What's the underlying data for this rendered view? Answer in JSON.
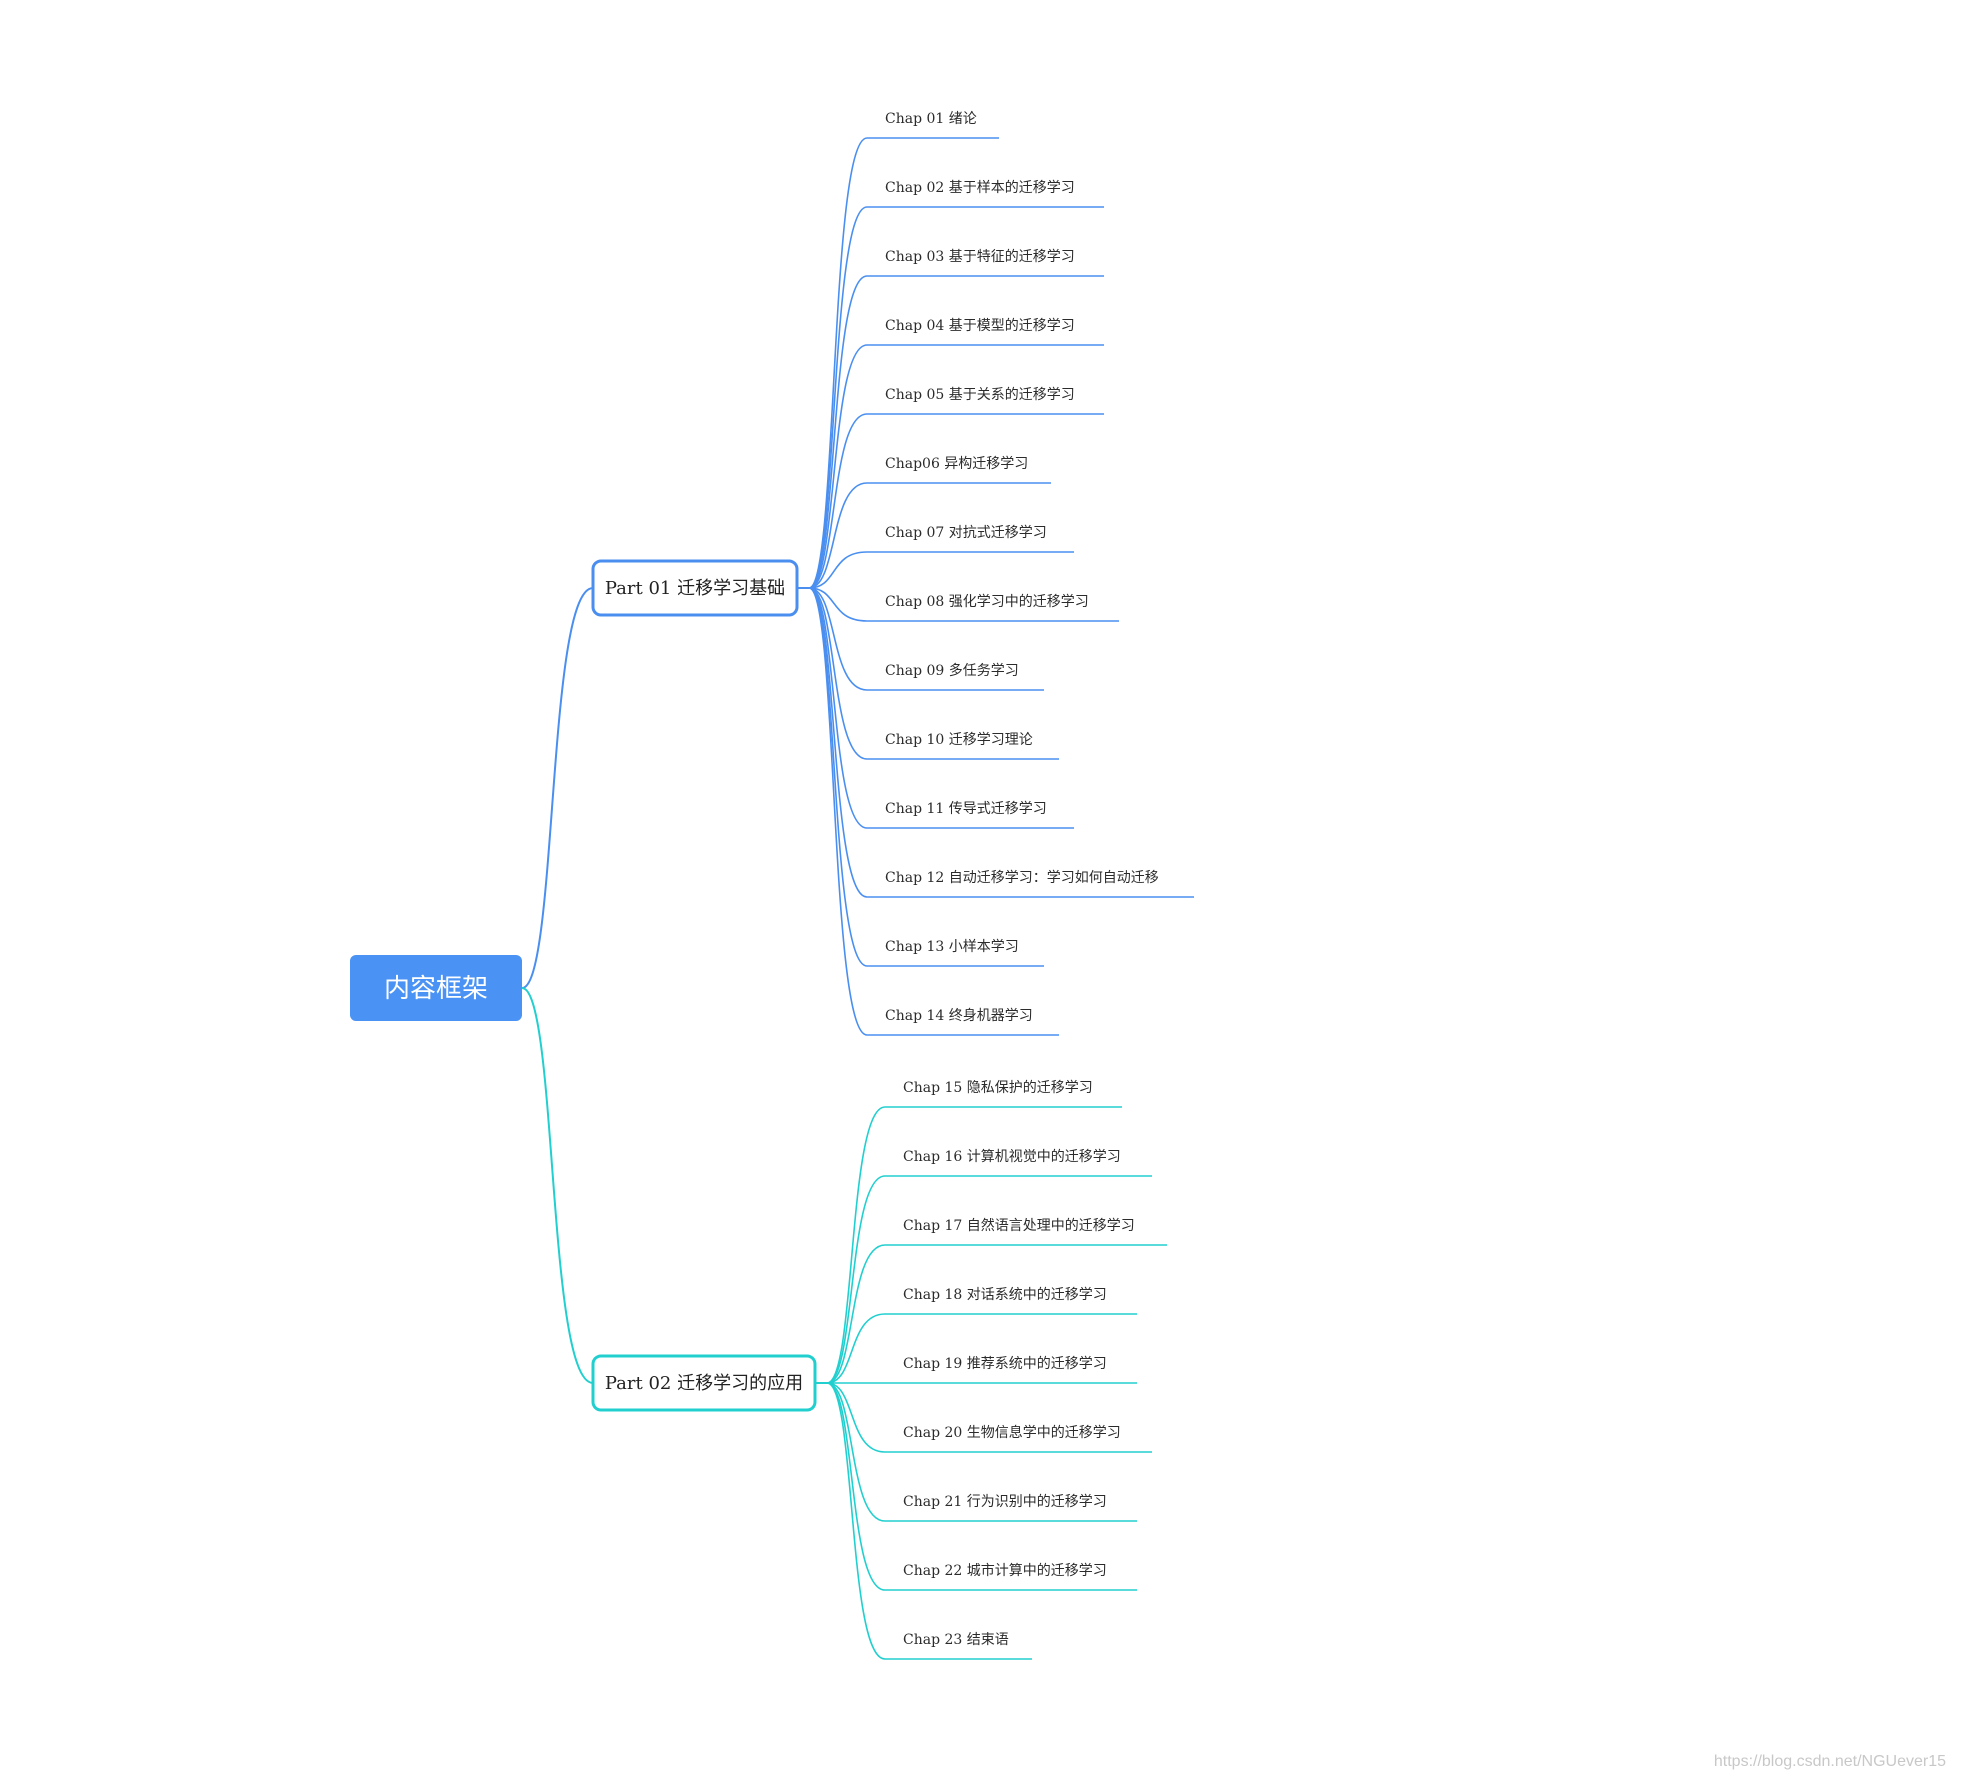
{
  "root": {
    "label": "内容框架",
    "color": "#4a93f4"
  },
  "branches": [
    {
      "label": "Part 01 迁移学习基础",
      "color": "#4a8ff0",
      "children": [
        "Chap 01 绪论",
        "Chap 02 基于样本的迁移学习",
        "Chap 03 基于特征的迁移学习",
        "Chap 04 基于模型的迁移学习",
        "Chap 05 基于关系的迁移学习",
        "Chap06 异构迁移学习",
        "Chap 07 对抗式迁移学习",
        "Chap 08 强化学习中的迁移学习",
        "Chap 09 多任务学习",
        "Chap 10 迁移学习理论",
        "Chap 11 传导式迁移学习",
        "Chap 12 自动迁移学习：学习如何自动迁移",
        "Chap 13 小样本学习",
        "Chap 14 终身机器学习"
      ]
    },
    {
      "label": "Part 02 迁移学习的应用",
      "color": "#22cfcf",
      "children": [
        "Chap 15 隐私保护的迁移学习",
        "Chap 16 计算机视觉中的迁移学习",
        "Chap 17 自然语言处理中的迁移学习",
        "Chap 18 对话系统中的迁移学习",
        "Chap 19 推荐系统中的迁移学习",
        "Chap 20 生物信息学中的迁移学习",
        "Chap 21 行为识别中的迁移学习",
        "Chap 22 城市计算中的迁移学习",
        "Chap 23 结束语"
      ]
    }
  ],
  "watermark": "https://blog.csdn.net/NGUever15"
}
